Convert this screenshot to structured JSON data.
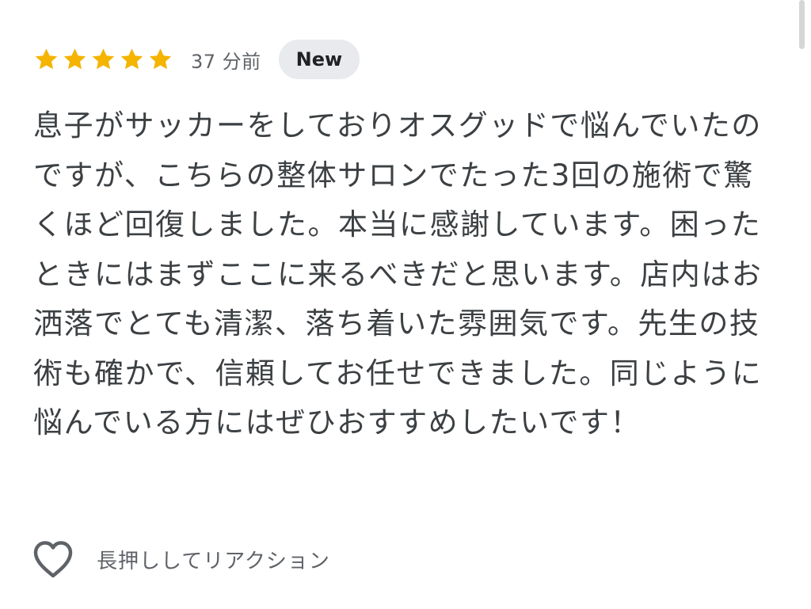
{
  "review": {
    "rating": 5,
    "rating_max": 5,
    "star_color": "#f4b400",
    "time_ago": "37 分前",
    "badge": "New",
    "text": "息子がサッカーをしておりオスグッドで悩んでいたのですが、こちらの整体サロンでたった3回の施術で驚くほど回復しました。本当に感謝しています。困ったときにはまずここに来るべきだと思います。店内はお洒落でとても清潔、落ち着いた雰囲気です。先生の技術も確かで、信頼してお任せできました。同じように悩んでいる方にはぜひおすすめしたいです！"
  },
  "reaction": {
    "icon": "heart-outline-icon",
    "label": "長押ししてリアクション"
  }
}
